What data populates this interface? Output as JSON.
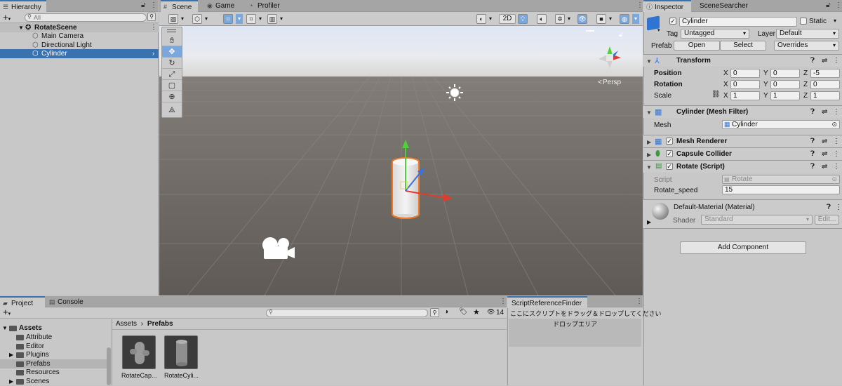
{
  "hierarchy": {
    "tab": "Hierarchy",
    "search_placeholder": "All",
    "scene_name": "RotateScene",
    "items": [
      "Main Camera",
      "Directional Light",
      "Cylinder"
    ]
  },
  "scene_tabs": [
    "Scene",
    "Game",
    "Profiler"
  ],
  "scene_toolbar": {
    "mode_2d": "2D"
  },
  "scene_view": {
    "persp_label": "Persp"
  },
  "inspector": {
    "tabs": [
      "Inspector",
      "SceneSearcher"
    ],
    "object_name": "Cylinder",
    "static_label": "Static",
    "tag_label": "Tag",
    "tag_value": "Untagged",
    "layer_label": "Layer",
    "layer_value": "Default",
    "prefab_label": "Prefab",
    "prefab_open": "Open",
    "prefab_select": "Select",
    "prefab_overrides": "Overrides",
    "transform": {
      "title": "Transform",
      "position_label": "Position",
      "rotation_label": "Rotation",
      "scale_label": "Scale",
      "position": {
        "x": "0",
        "y": "0",
        "z": "-5"
      },
      "rotation": {
        "x": "0",
        "y": "0",
        "z": "0"
      },
      "scale": {
        "x": "1",
        "y": "1",
        "z": "1"
      }
    },
    "mesh_filter": {
      "title": "Cylinder (Mesh Filter)",
      "mesh_label": "Mesh",
      "mesh_value": "Cylinder"
    },
    "mesh_renderer": {
      "title": "Mesh Renderer"
    },
    "capsule_collider": {
      "title": "Capsule Collider"
    },
    "rotate_script": {
      "title": "Rotate (Script)",
      "script_label": "Script",
      "script_value": "Rotate",
      "speed_label": "Rotate_speed",
      "speed_value": "15"
    },
    "material": {
      "title": "Default-Material (Material)",
      "shader_label": "Shader",
      "shader_value": "Standard",
      "edit_label": "Edit..."
    },
    "add_component": "Add Component"
  },
  "project": {
    "tabs": [
      "Project",
      "Console"
    ],
    "asset_count": "14",
    "tree_root": "Assets",
    "tree_items": [
      "Attribute",
      "Editor",
      "Plugins",
      "Prefabs",
      "Resources",
      "Scenes"
    ],
    "breadcrumb_root": "Assets",
    "breadcrumb_current": "Prefabs",
    "assets": [
      "RotateCap...",
      "RotateCyli..."
    ]
  },
  "script_finder": {
    "tab": "ScriptReferenceFinder",
    "instruction": "ここにスクリプトをドラッグ＆ドロップしてください",
    "drop_area": "ドロップエリア"
  },
  "colors": {
    "accent": "#3a72b0",
    "selection_orange": "#f07a25",
    "sky_top": "#e6ecf7",
    "ground": "#5f5a55"
  }
}
